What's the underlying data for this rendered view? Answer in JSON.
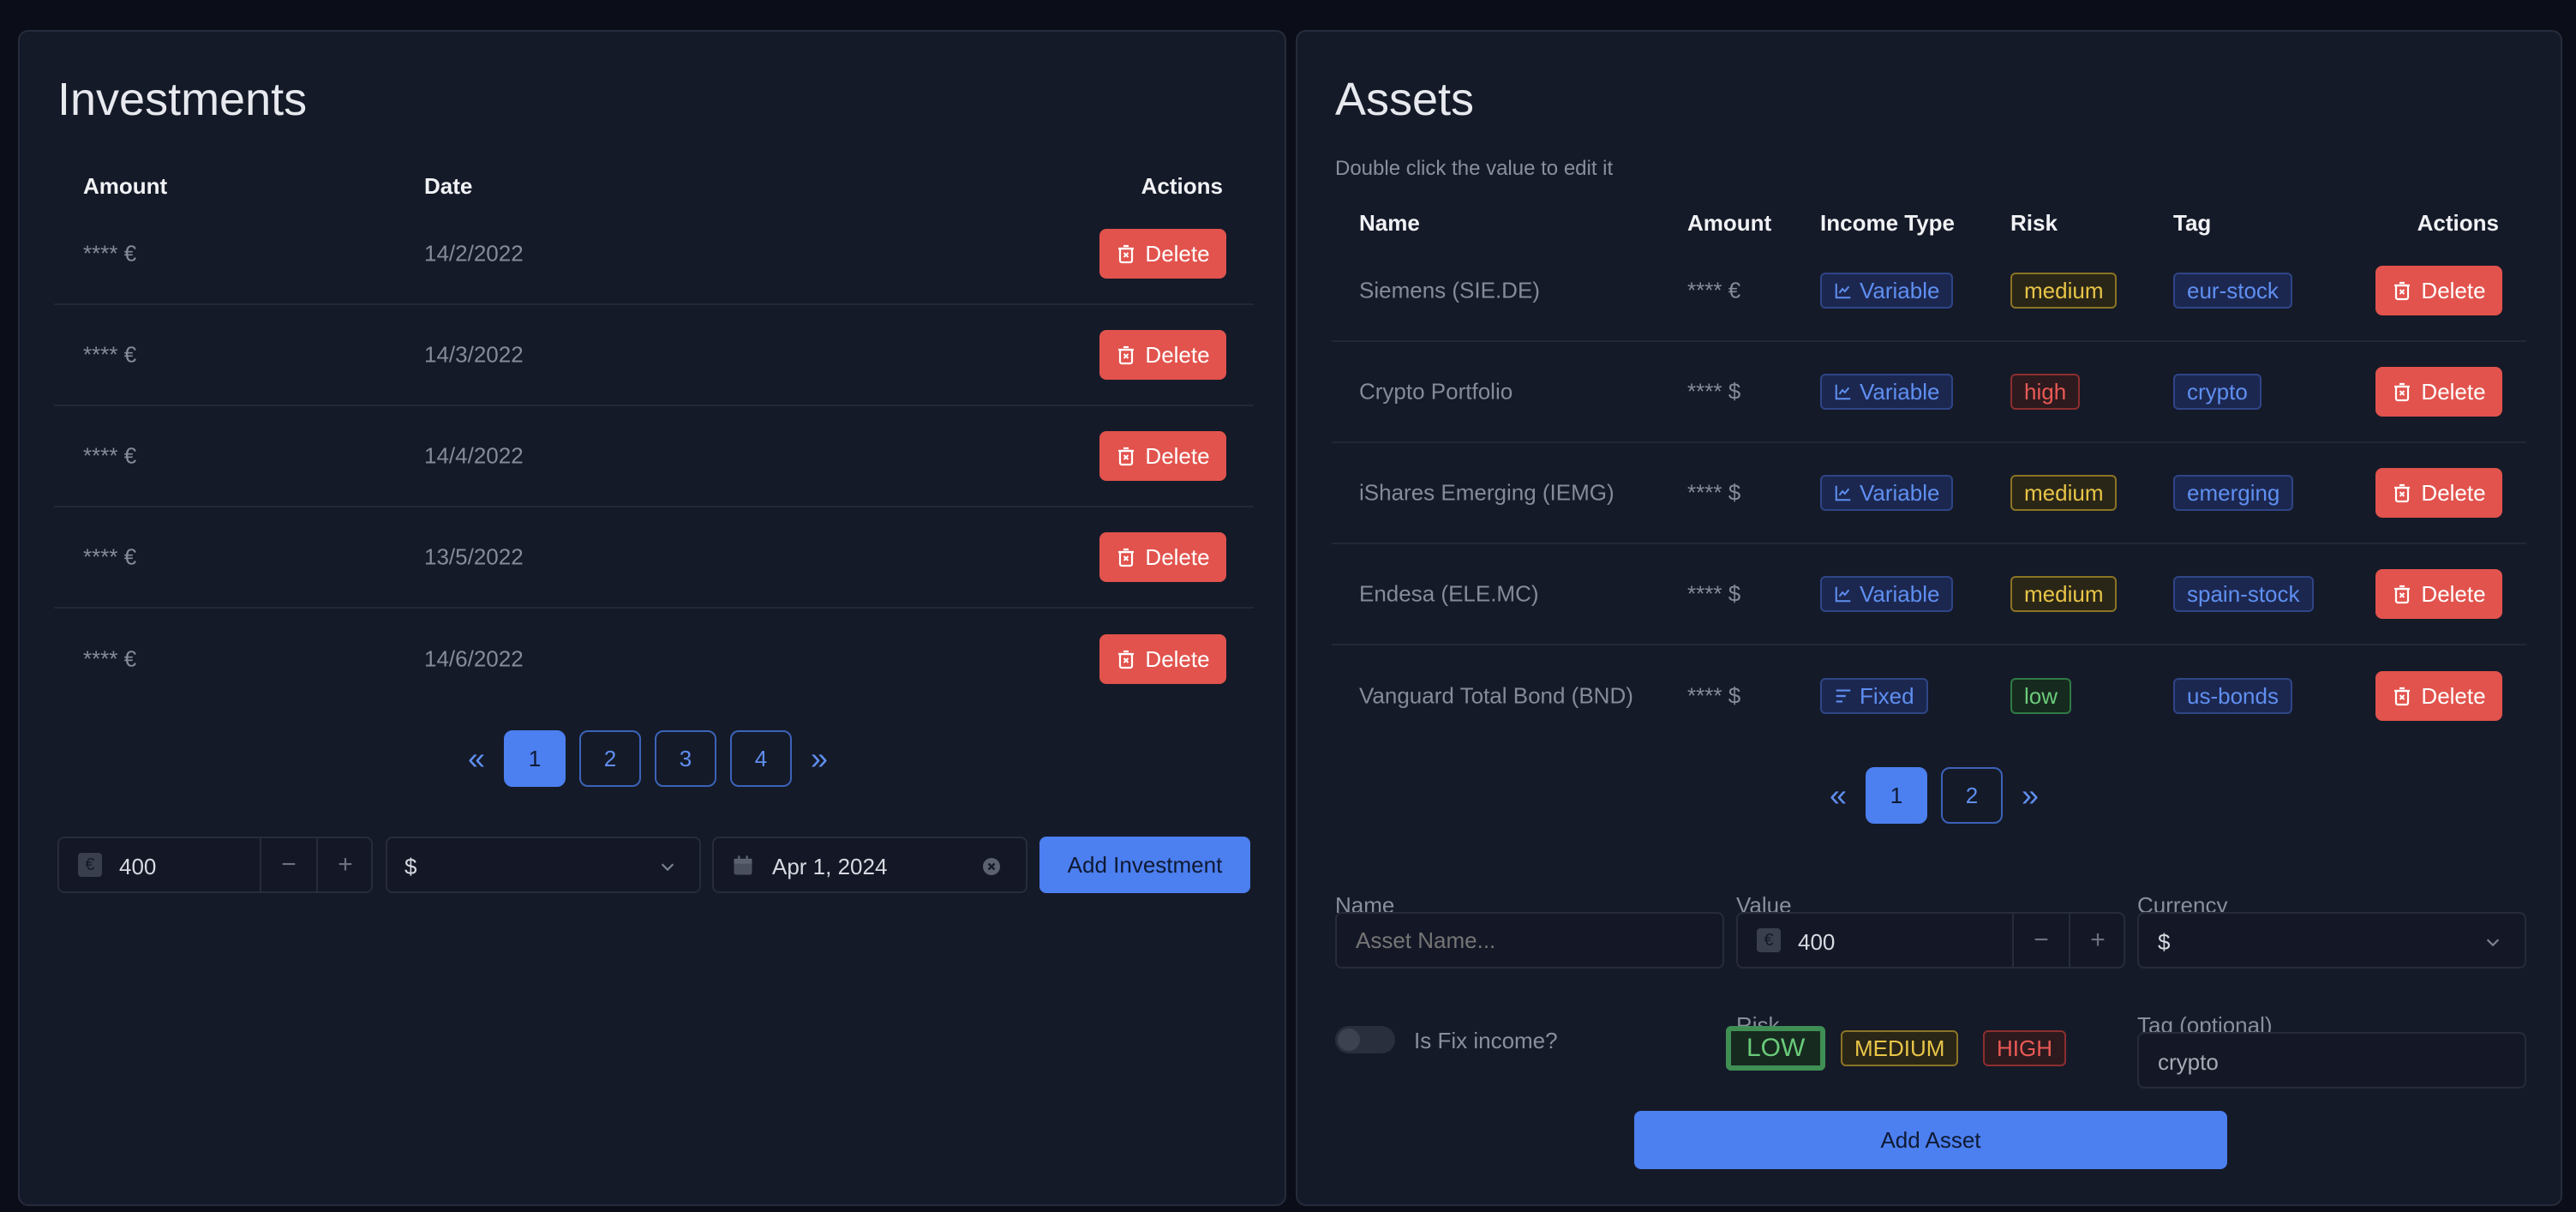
{
  "investments": {
    "title": "Investments",
    "headers": {
      "amount": "Amount",
      "date": "Date",
      "actions": "Actions"
    },
    "rows": [
      {
        "amount": "**** €",
        "date": "14/2/2022"
      },
      {
        "amount": "**** €",
        "date": "14/3/2022"
      },
      {
        "amount": "**** €",
        "date": "14/4/2022"
      },
      {
        "amount": "**** €",
        "date": "13/5/2022"
      },
      {
        "amount": "**** €",
        "date": "14/6/2022"
      }
    ],
    "delete_label": "Delete",
    "pagination": {
      "pages": [
        "1",
        "2",
        "3",
        "4"
      ],
      "current": "1"
    },
    "form": {
      "amount_value": "400",
      "currency_symbol": "€",
      "minus": "−",
      "plus": "+",
      "currency_select": "$",
      "date_value": "Apr 1, 2024",
      "submit_label": "Add Investment"
    }
  },
  "assets": {
    "title": "Assets",
    "hint": "Double click the value to edit it",
    "headers": {
      "name": "Name",
      "amount": "Amount",
      "income_type": "Income Type",
      "risk": "Risk",
      "tag": "Tag",
      "actions": "Actions"
    },
    "rows": [
      {
        "name": "Siemens (SIE.DE)",
        "amount": "**** €",
        "income": "Variable",
        "income_icon": "chart-line-icon",
        "risk": "medium",
        "tag": "eur-stock"
      },
      {
        "name": "Crypto Portfolio",
        "amount": "**** $",
        "income": "Variable",
        "income_icon": "chart-line-icon",
        "risk": "high",
        "tag": "crypto"
      },
      {
        "name": "iShares Emerging (IEMG)",
        "amount": "**** $",
        "income": "Variable",
        "income_icon": "chart-line-icon",
        "risk": "medium",
        "tag": "emerging"
      },
      {
        "name": "Endesa (ELE.MC)",
        "amount": "**** $",
        "income": "Variable",
        "income_icon": "chart-line-icon",
        "risk": "medium",
        "tag": "spain-stock"
      },
      {
        "name": "Vanguard Total Bond (BND)",
        "amount": "**** $",
        "income": "Fixed",
        "income_icon": "align-left-icon",
        "risk": "low",
        "tag": "us-bonds"
      }
    ],
    "delete_label": "Delete",
    "pagination": {
      "pages": [
        "1",
        "2"
      ],
      "current": "1"
    },
    "form": {
      "name_label": "Name",
      "name_placeholder": "Asset Name...",
      "value_label": "Value",
      "value_value": "400",
      "currency_symbol": "€",
      "minus": "−",
      "plus": "+",
      "currency_label": "Currency",
      "currency_select": "$",
      "fix_income_label": "Is Fix income?",
      "fix_income_on": false,
      "risk_label": "Risk",
      "risk_options": [
        "LOW",
        "MEDIUM",
        "HIGH"
      ],
      "risk_selected": "LOW",
      "tag_label": "Tag (optional)",
      "tag_value": "crypto",
      "submit_label": "Add Asset"
    }
  },
  "colors": {
    "background": "#0b0e18",
    "panel": "#151a28",
    "accent": "#4c7ff0",
    "danger": "#e2534d",
    "warning": "#e8c548",
    "success": "#6acb7a"
  }
}
